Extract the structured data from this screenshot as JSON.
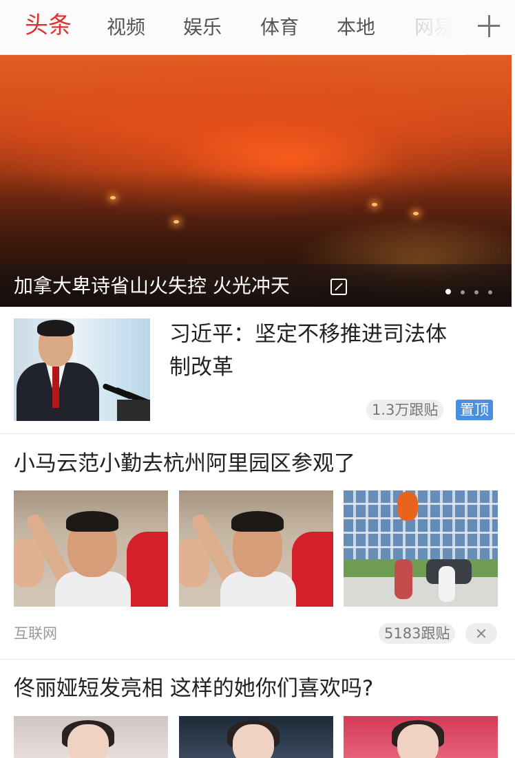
{
  "tabs": [
    {
      "label": "头条",
      "active": true
    },
    {
      "label": "视频"
    },
    {
      "label": "娱乐"
    },
    {
      "label": "体育"
    },
    {
      "label": "本地"
    },
    {
      "label": "网易"
    }
  ],
  "hero": {
    "caption": "加拿大卑诗省山火失控 火光冲天",
    "slide_count": 4,
    "active_slide": 1,
    "image_icon": "gallery-icon"
  },
  "articles": [
    {
      "title": "习近平：坚定不移推进司法体制改革",
      "title_line1": "习近平：坚定不移推进司法体",
      "title_line2": "制改革",
      "comments": "1.3万跟贴",
      "tag": "置顶"
    },
    {
      "title": "小马云范小勤去杭州阿里园区参观了",
      "source": "互联网",
      "comments": "5183跟贴"
    },
    {
      "title": "佟丽娅短发亮相 这样的她你们喜欢吗?"
    }
  ],
  "colors": {
    "active_tab": "#e0312f",
    "sticky_tag": "#4a8ee0"
  }
}
